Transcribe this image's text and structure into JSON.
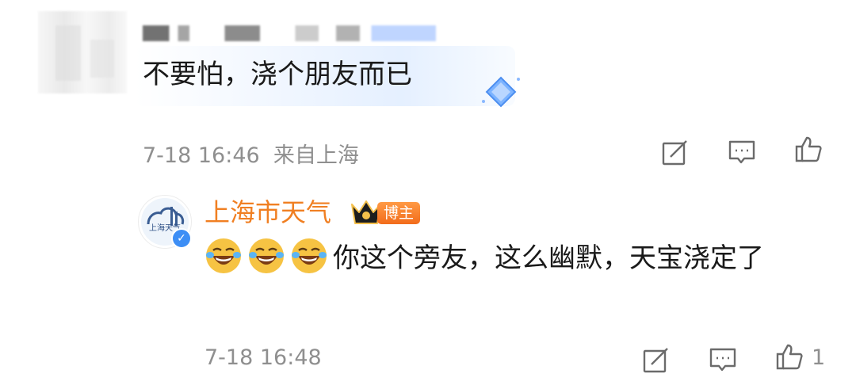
{
  "comment": {
    "text": "不要怕，浇个朋友而已",
    "time": "7-18 16:46",
    "location": "来自上海",
    "actions": [
      "share-icon",
      "comment-icon",
      "like-icon"
    ]
  },
  "reply": {
    "author": "上海市天气",
    "avatar_text": "上海天气",
    "badge": "博主",
    "emoji_count": 3,
    "text": "你这个旁友，这么幽默，天宝浇定了",
    "time": "7-18 16:48",
    "likes": "1",
    "actions": [
      "share-icon",
      "comment-icon",
      "like-icon"
    ]
  },
  "colors": {
    "name": "#f07f22",
    "meta": "#8f8f8f",
    "verified": "#3d8ef5",
    "badge": "#f26c1b"
  }
}
